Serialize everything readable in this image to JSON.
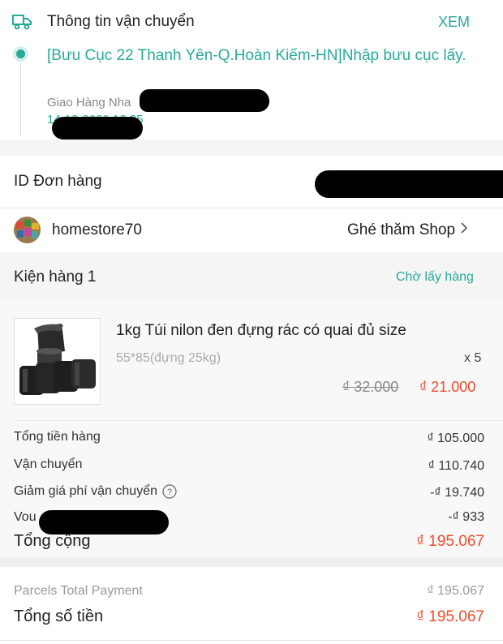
{
  "shipping": {
    "title": "Thông tin vận chuyển",
    "view_label": "XEM",
    "status": "[Bưu Cục 22 Thanh Yên-Q.Hoàn Kiếm-HN]Nhập bưu cục lấy.",
    "carrier": "Giao Hàng Nha",
    "time": "14-12-2020 16:35"
  },
  "order": {
    "id_label": "ID Đơn hàng"
  },
  "shop": {
    "name": "homestore70",
    "visit_label": "Ghé thăm Shop"
  },
  "package": {
    "title": "Kiện hàng 1",
    "status": "Chờ lấy hàng"
  },
  "product": {
    "name": "1kg Túi nilon đen đựng rác có quai đủ size",
    "variant": "55*85(đựng 25kg)",
    "quantity": "x 5",
    "original_price": "₫ 32.000",
    "sale_price": "₫ 21.000"
  },
  "summary": {
    "subtotal_label": "Tổng tiền hàng",
    "subtotal_value": "₫ 105.000",
    "shipping_label": "Vận chuyển",
    "shipping_value": "₫ 110.740",
    "shipping_discount_label": "Giảm giá phí vận chuyển",
    "shipping_discount_value": "-₫ 19.740",
    "voucher_label": "Vou",
    "voucher_value": "-₫ 933",
    "total_label": "Tổng cộng",
    "total_value": "₫ 195.067"
  },
  "payment": {
    "parcels_label": "Parcels Total Payment",
    "parcels_value": "₫ 195.067",
    "grand_label": "Tổng số tiền",
    "grand_value": "₫ 195.067"
  },
  "colors": {
    "accent": "#26aa99",
    "price": "#ee4d2d",
    "background_band": "#f5f5f5"
  }
}
